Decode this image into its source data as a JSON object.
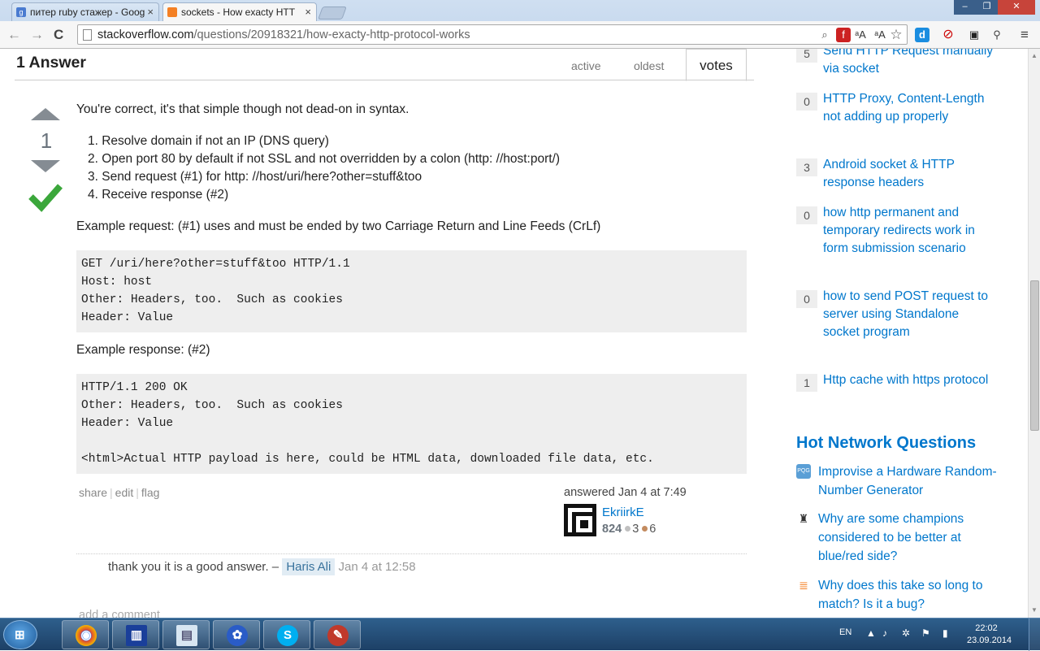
{
  "browser": {
    "tabs": [
      {
        "title": "питер ruby стажер - Goog",
        "close": "×"
      },
      {
        "title": "sockets - How exacty HTT",
        "close": "×"
      }
    ],
    "window_buttons": {
      "minimize": "–",
      "maximize": "❐",
      "close": "✕"
    },
    "nav": {
      "back": "←",
      "forward": "→",
      "reload": "C"
    },
    "url_host": "stackoverflow.com",
    "url_path": "/questions/20918321/how-exacty-http-protocol-works",
    "extensions": {
      "translate1": "ᵃA",
      "translate2": "ᵃA",
      "star": "☆",
      "menu": "≡"
    }
  },
  "answers": {
    "header": "1 Answer",
    "sort_tabs": {
      "active": "active",
      "oldest": "oldest",
      "votes": "votes"
    },
    "vote_count": "1",
    "body": {
      "intro": "You're correct, it's that simple though not dead-on in syntax.",
      "steps": [
        "1.  Resolve domain if not an IP (DNS query)",
        "2.  Open port 80 by default if not SSL and not overridden by a colon (http: //host:port/)",
        "3.  Send request (#1) for http: //host/uri/here?other=stuff&too",
        "4.  Receive response (#2)"
      ],
      "request_label": "Example request: (#1) uses and must be ended by two Carriage Return and Line Feeds (CrLf)",
      "request_code": [
        "GET /uri/here?other=stuff&too HTTP/1.1",
        "Host: host",
        "Other: Headers, too.  Such as cookies",
        "Header: Value"
      ],
      "response_label": "Example response: (#2)",
      "response_code": [
        "HTTP/1.1 200 OK",
        "Other: Headers, too.  Such as cookies",
        "Header: Value",
        "",
        "<html>Actual HTTP payload is here, could be HTML data, downloaded file data, etc."
      ]
    },
    "actions": {
      "share": "share",
      "edit": "edit",
      "flag": "flag"
    },
    "answered": "answered Jan 4 at 7:49",
    "user": {
      "name": "EkriirkE",
      "reputation": "824",
      "silver": "3",
      "bronze": "6"
    },
    "comment": {
      "text": "thank you it is a good answer. –",
      "user": "Haris Ali",
      "date": "Jan 4 at 12:58"
    },
    "add_comment": "add a comment"
  },
  "sidebar": {
    "related": [
      {
        "count": "5",
        "title": "Send HTTP Request manually via socket"
      },
      {
        "count": "0",
        "title": "HTTP Proxy, Content-Length not adding up properly"
      },
      {
        "count": "3",
        "title": "Android socket & HTTP response headers"
      },
      {
        "count": "0",
        "title": "how http permanent and temporary redirects work in form submission scenario"
      },
      {
        "count": "0",
        "title": "how to send POST request to server using Standalone socket program"
      },
      {
        "count": "1",
        "title": "Http cache with https protocol"
      }
    ],
    "hot_title": "Hot Network Questions",
    "hot": [
      {
        "icon": "code-review-icon",
        "title": "Improvise a Hardware Random-Number Generator"
      },
      {
        "icon": "arqade-icon",
        "title": "Why are some champions considered to be better at blue/red side?"
      },
      {
        "icon": "stackoverflow-icon",
        "title": "Why does this take so long to match? Is it a bug?"
      }
    ]
  },
  "taskbar": {
    "lang": "EN",
    "time": "22:02",
    "date": "23.09.2014",
    "apps": [
      {
        "icon": "chrome-icon",
        "glyph": "◉"
      },
      {
        "icon": "far-manager-icon",
        "glyph": "▥"
      },
      {
        "icon": "notepad-icon",
        "glyph": "▤"
      },
      {
        "icon": "flower-app-icon",
        "glyph": "✿"
      },
      {
        "icon": "skype-icon",
        "glyph": "S"
      },
      {
        "icon": "pencil-icon",
        "glyph": "✎"
      }
    ]
  },
  "colors": {
    "link": "#0077cc",
    "accept": "#3ba73b",
    "code_bg": "#eeeeee",
    "taskbar": "#1d4066"
  }
}
